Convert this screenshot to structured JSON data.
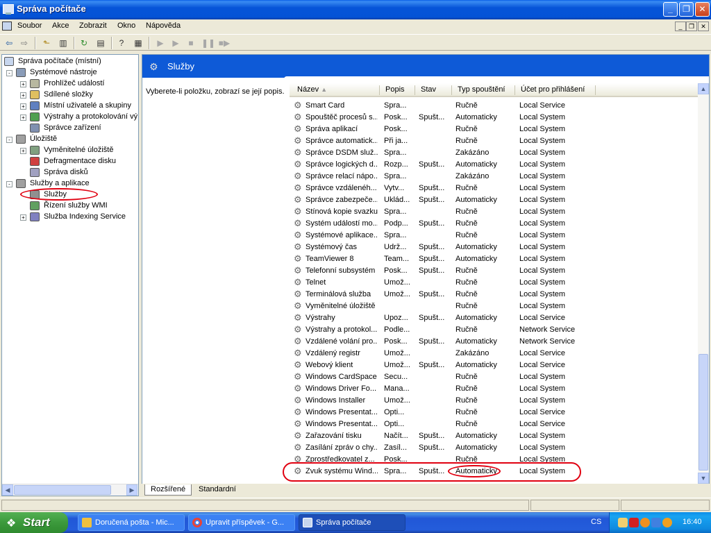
{
  "window": {
    "title": "Správa počítače"
  },
  "menu": [
    "Soubor",
    "Akce",
    "Zobrazit",
    "Okno",
    "Nápověda"
  ],
  "tree": [
    {
      "label": "Správa počítače (místní)",
      "level": 0,
      "expander": ""
    },
    {
      "label": "Systémové nástroje",
      "level": 1,
      "expander": "-"
    },
    {
      "label": "Prohlížeč událostí",
      "level": 2,
      "expander": "+"
    },
    {
      "label": "Sdílené složky",
      "level": 2,
      "expander": "+"
    },
    {
      "label": "Místní uživatelé a skupiny",
      "level": 2,
      "expander": "+"
    },
    {
      "label": "Výstrahy a protokolování vý",
      "level": 2,
      "expander": "+"
    },
    {
      "label": "Správce zařízení",
      "level": 2,
      "expander": ""
    },
    {
      "label": "Úložiště",
      "level": 1,
      "expander": "-"
    },
    {
      "label": "Vyměnitelné úložiště",
      "level": 2,
      "expander": "+"
    },
    {
      "label": "Defragmentace disku",
      "level": 2,
      "expander": ""
    },
    {
      "label": "Správa disků",
      "level": 2,
      "expander": ""
    },
    {
      "label": "Služby a aplikace",
      "level": 1,
      "expander": "-"
    },
    {
      "label": "Služby",
      "level": 2,
      "expander": ""
    },
    {
      "label": "Řízení služby WMI",
      "level": 2,
      "expander": ""
    },
    {
      "label": "Služba Indexing Service",
      "level": 2,
      "expander": "+"
    }
  ],
  "pane": {
    "title": "Služby",
    "description": "Vyberete-li položku, zobrazí se její popis."
  },
  "columns": [
    "Název",
    "Popis",
    "Stav",
    "Typ spouštění",
    "Účet pro přihlášení"
  ],
  "services": [
    [
      "Smart Card",
      "Spra...",
      "",
      "Ručně",
      "Local Service"
    ],
    [
      "Spouštěč procesů s...",
      "Posk...",
      "Spušt...",
      "Automaticky",
      "Local System"
    ],
    [
      "Správa aplikací",
      "Posk...",
      "",
      "Ručně",
      "Local System"
    ],
    [
      "Správce automatick...",
      "Při ja...",
      "",
      "Ručně",
      "Local System"
    ],
    [
      "Správce DSDM služ...",
      "Spra...",
      "",
      "Zakázáno",
      "Local System"
    ],
    [
      "Správce logických d...",
      "Rozp...",
      "Spušt...",
      "Automaticky",
      "Local System"
    ],
    [
      "Správce relací nápo...",
      "Spra...",
      "",
      "Zakázáno",
      "Local System"
    ],
    [
      "Správce vzdálenéh...",
      "Vytv...",
      "Spušt...",
      "Ručně",
      "Local System"
    ],
    [
      "Správce zabezpeče...",
      "Uklád...",
      "Spušt...",
      "Automaticky",
      "Local System"
    ],
    [
      "Stínová kopie svazku",
      "Spra...",
      "",
      "Ručně",
      "Local System"
    ],
    [
      "Systém událostí mo...",
      "Podp...",
      "Spušt...",
      "Ručně",
      "Local System"
    ],
    [
      "Systémové aplikace...",
      "Spra...",
      "",
      "Ručně",
      "Local System"
    ],
    [
      "Systémový čas",
      "Udrž...",
      "Spušt...",
      "Automaticky",
      "Local System"
    ],
    [
      "TeamViewer 8",
      "Team...",
      "Spušt...",
      "Automaticky",
      "Local System"
    ],
    [
      "Telefonní subsystém",
      "Posk...",
      "Spušt...",
      "Ručně",
      "Local System"
    ],
    [
      "Telnet",
      "Umož...",
      "",
      "Ručně",
      "Local System"
    ],
    [
      "Terminálová služba",
      "Umož...",
      "Spušt...",
      "Ručně",
      "Local System"
    ],
    [
      "Vyměnitelné úložiště",
      "",
      "",
      "Ručně",
      "Local System"
    ],
    [
      "Výstrahy",
      "Upoz...",
      "Spušt...",
      "Automaticky",
      "Local Service"
    ],
    [
      "Výstrahy a protokol...",
      "Podle...",
      "",
      "Ručně",
      "Network Service"
    ],
    [
      "Vzdálené volání pro...",
      "Posk...",
      "Spušt...",
      "Automaticky",
      "Network Service"
    ],
    [
      "Vzdálený registr",
      "Umož...",
      "",
      "Zakázáno",
      "Local Service"
    ],
    [
      "Webový klient",
      "Umož...",
      "Spušt...",
      "Automaticky",
      "Local Service"
    ],
    [
      "Windows CardSpace",
      "Secu...",
      "",
      "Ručně",
      "Local System"
    ],
    [
      "Windows Driver Fo...",
      "Mana...",
      "",
      "Ručně",
      "Local System"
    ],
    [
      "Windows Installer",
      "Umož...",
      "",
      "Ručně",
      "Local System"
    ],
    [
      "Windows Presentat...",
      "Opti...",
      "",
      "Ručně",
      "Local Service"
    ],
    [
      "Windows Presentat...",
      "Opti...",
      "",
      "Ručně",
      "Local Service"
    ],
    [
      "Zařazování tisku",
      "Načít...",
      "Spušt...",
      "Automaticky",
      "Local System"
    ],
    [
      "Zasílání zpráv o chy...",
      "Zasíl...",
      "Spušt...",
      "Automaticky",
      "Local System"
    ],
    [
      "Zprostředkovatel z...",
      "Posk...",
      "",
      "Ručně",
      "Local System"
    ],
    [
      "Zvuk systému Wind...",
      "Spra...",
      "Spušt...",
      "Automaticky",
      "Local System"
    ]
  ],
  "tabs": [
    "Rozšířené",
    "Standardní"
  ],
  "taskbar": {
    "start": "Start",
    "tasks": [
      "Doručená pošta - Mic...",
      "Upravit příspěvek - G...",
      "Správa počítače"
    ],
    "language": "CS",
    "clock": "16:40"
  },
  "colors": {
    "accent": "#0e5ad7",
    "highlight_ellipse": "#e00010"
  }
}
